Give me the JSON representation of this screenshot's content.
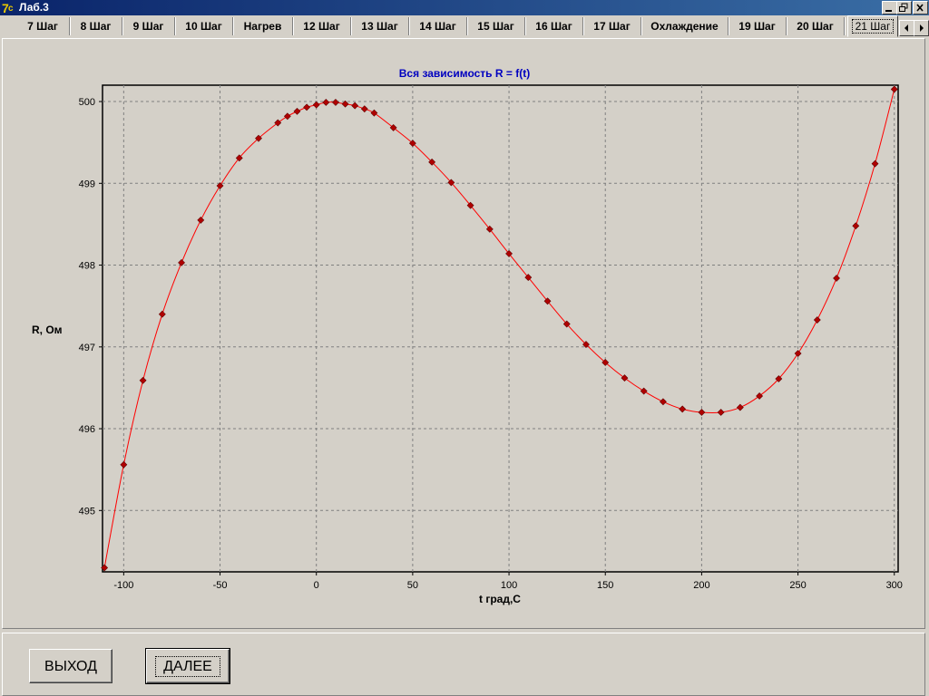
{
  "window": {
    "title": "Лаб.3"
  },
  "tabs": [
    {
      "label": "7 Шаг"
    },
    {
      "label": "8 Шаг"
    },
    {
      "label": "9 Шаг"
    },
    {
      "label": "10 Шаг"
    },
    {
      "label": "Нагрев"
    },
    {
      "label": "12 Шаг"
    },
    {
      "label": "13 Шаг"
    },
    {
      "label": "14 Шаг"
    },
    {
      "label": "15 Шаг"
    },
    {
      "label": "16 Шаг"
    },
    {
      "label": "17 Шаг"
    },
    {
      "label": "Охлаждение"
    },
    {
      "label": "19 Шаг"
    },
    {
      "label": "20 Шаг"
    },
    {
      "label": "21 Шаг"
    }
  ],
  "active_tab": "21 Шаг",
  "buttons": {
    "exit": "ВЫХОД",
    "next": "ДАЛЕЕ"
  },
  "colors": {
    "title_blue": "#0000c0",
    "curve": "#ff0000",
    "marker": "#b00000"
  },
  "chart_data": {
    "type": "line",
    "title": "Вся зависимость R = f(t)",
    "xlabel": "t град,С",
    "ylabel": "R, Ом",
    "xlim": [
      -111,
      302
    ],
    "ylim": [
      494.25,
      500.2
    ],
    "xticks": [
      -100,
      -50,
      0,
      50,
      100,
      150,
      200,
      250,
      300
    ],
    "yticks": [
      495,
      496,
      497,
      498,
      499,
      500
    ],
    "grid": true,
    "x": [
      -110,
      -100,
      -90,
      -80,
      -70,
      -60,
      -50,
      -40,
      -30,
      -20,
      -15,
      -10,
      -5,
      0,
      5,
      10,
      15,
      20,
      25,
      30,
      40,
      50,
      60,
      70,
      80,
      90,
      100,
      110,
      120,
      130,
      140,
      150,
      160,
      170,
      180,
      190,
      200,
      210,
      220,
      230,
      240,
      250,
      260,
      270,
      280,
      290,
      300
    ],
    "y": [
      494.3,
      495.56,
      496.59,
      497.4,
      498.03,
      498.55,
      498.97,
      499.31,
      499.55,
      499.74,
      499.82,
      499.88,
      499.93,
      499.96,
      499.99,
      499.99,
      499.97,
      499.95,
      499.91,
      499.86,
      499.68,
      499.49,
      499.26,
      499.01,
      498.73,
      498.44,
      498.14,
      497.85,
      497.56,
      497.28,
      497.03,
      496.81,
      496.62,
      496.46,
      496.33,
      496.24,
      496.2,
      496.2,
      496.26,
      496.4,
      496.61,
      496.92,
      497.33,
      497.84,
      498.48,
      499.24,
      500.15
    ]
  }
}
